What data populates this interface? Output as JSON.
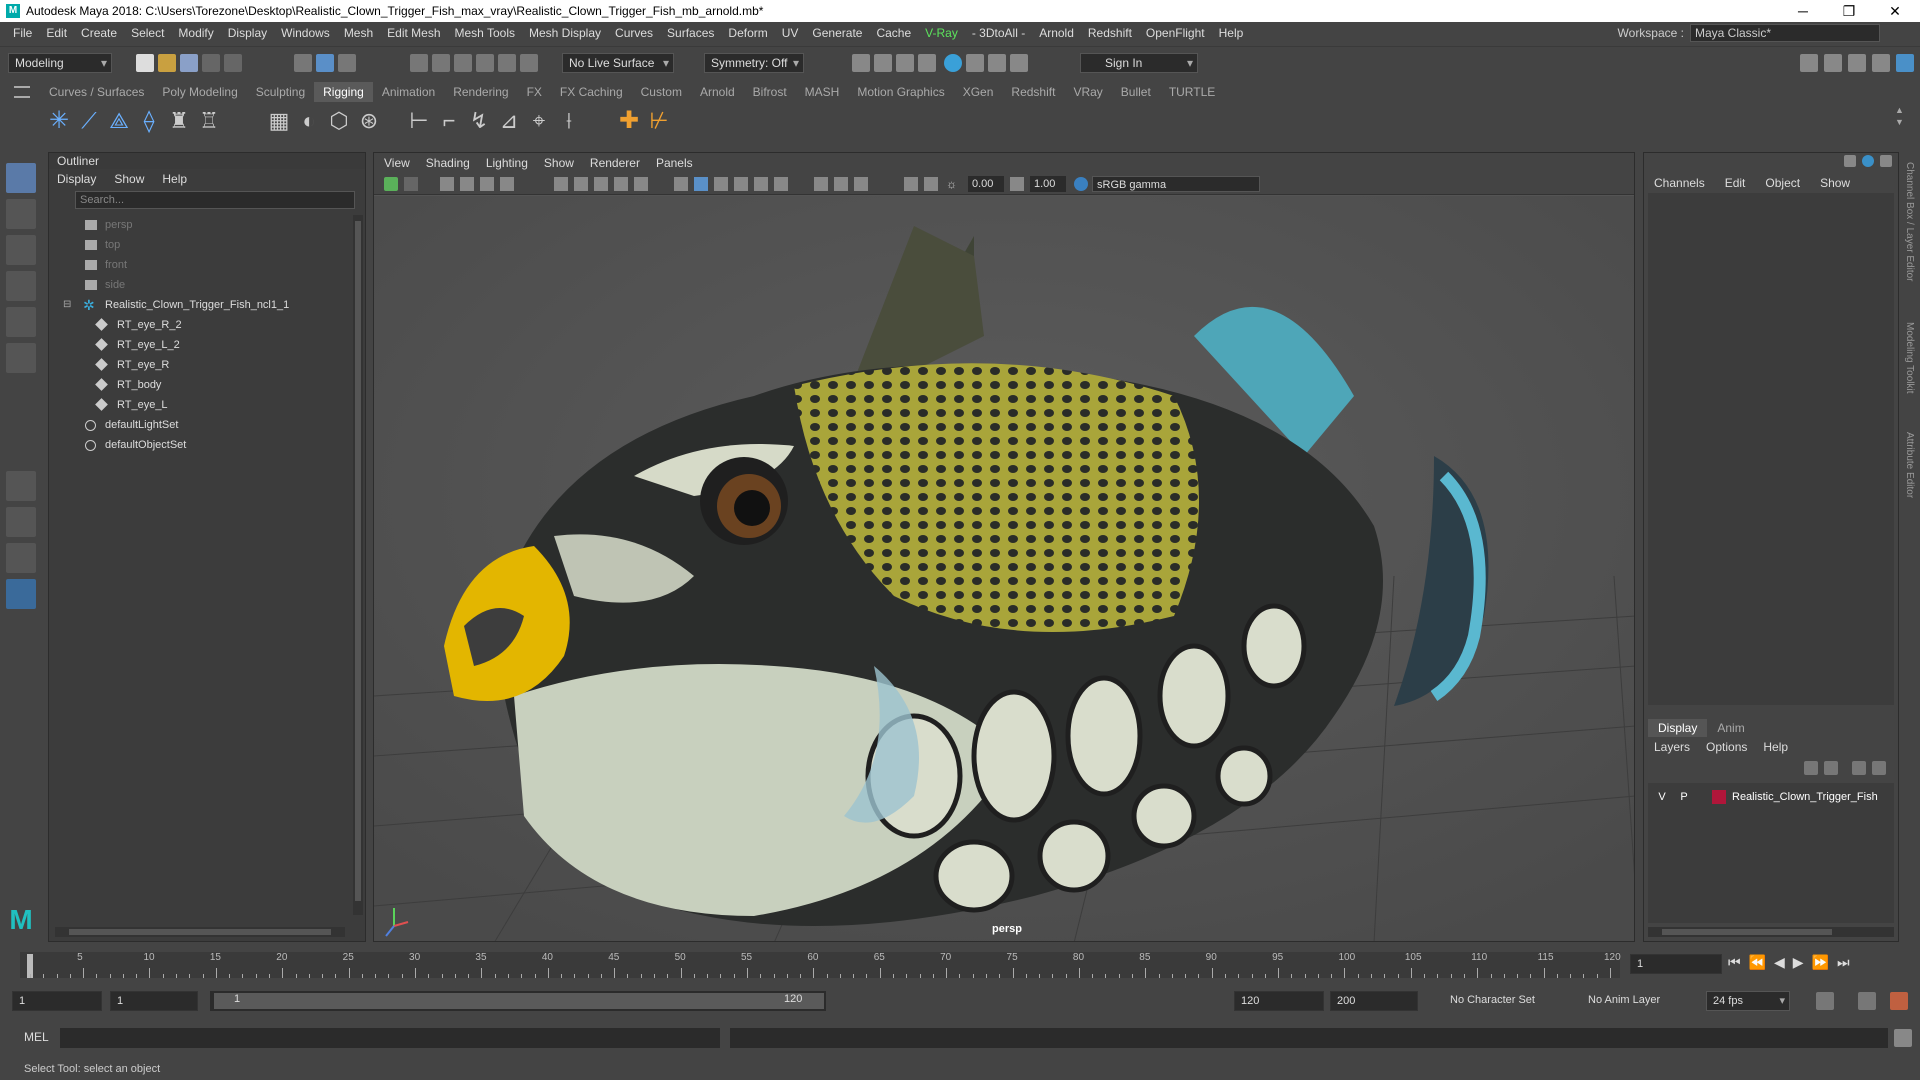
{
  "titlebar": {
    "logo": "M",
    "title": "Autodesk Maya 2018: C:\\Users\\Torezone\\Desktop\\Realistic_Clown_Trigger_Fish_max_vray\\Realistic_Clown_Trigger_Fish_mb_arnold.mb*",
    "min": "─",
    "max": "❐",
    "close": "✕"
  },
  "menubar": {
    "items": [
      "File",
      "Edit",
      "Create",
      "Select",
      "Modify",
      "Display",
      "Windows",
      "Mesh",
      "Edit Mesh",
      "Mesh Tools",
      "Mesh Display",
      "Curves",
      "Surfaces",
      "Deform",
      "UV",
      "Generate",
      "Cache",
      "V-Ray",
      "- 3DtoAll -",
      "Arnold",
      "Redshift",
      "OpenFlight",
      "Help"
    ]
  },
  "workspace": {
    "label": "Workspace :",
    "value": "Maya Classic*"
  },
  "statusline": {
    "mode": "Modeling",
    "live_surface": "No Live Surface",
    "symmetry": "Symmetry: Off",
    "sign_in": "Sign In"
  },
  "shelf": {
    "tabs": [
      "Curves / Surfaces",
      "Poly Modeling",
      "Sculpting",
      "Rigging",
      "Animation",
      "Rendering",
      "FX",
      "FX Caching",
      "Custom",
      "Arnold",
      "Bifrost",
      "MASH",
      "Motion Graphics",
      "XGen",
      "Redshift",
      "VRay",
      "Bullet",
      "TURTLE"
    ],
    "active": "Rigging"
  },
  "outliner": {
    "title": "Outliner",
    "menu": [
      "Display",
      "Show",
      "Help"
    ],
    "search_placeholder": "Search...",
    "items": [
      {
        "label": "persp",
        "kind": "camera",
        "depth": 0
      },
      {
        "label": "top",
        "kind": "camera",
        "depth": 0
      },
      {
        "label": "front",
        "kind": "camera",
        "depth": 0
      },
      {
        "label": "side",
        "kind": "camera",
        "depth": 0
      },
      {
        "label": "Realistic_Clown_Trigger_Fish_ncl1_1",
        "kind": "group",
        "depth": 0
      },
      {
        "label": "RT_eye_R_2",
        "kind": "mesh",
        "depth": 1
      },
      {
        "label": "RT_eye_L_2",
        "kind": "mesh",
        "depth": 1
      },
      {
        "label": "RT_eye_R",
        "kind": "mesh",
        "depth": 1
      },
      {
        "label": "RT_body",
        "kind": "mesh",
        "depth": 1
      },
      {
        "label": "RT_eye_L",
        "kind": "mesh",
        "depth": 1
      },
      {
        "label": "defaultLightSet",
        "kind": "set",
        "depth": 0
      },
      {
        "label": "defaultObjectSet",
        "kind": "set",
        "depth": 0
      }
    ]
  },
  "viewport": {
    "menu": [
      "View",
      "Shading",
      "Lighting",
      "Show",
      "Renderer",
      "Panels"
    ],
    "exposure": "0.00",
    "gamma": "1.00",
    "color_space": "sRGB gamma",
    "camera_label": "persp"
  },
  "channelbox": {
    "menu": [
      "Channels",
      "Edit",
      "Object",
      "Show"
    ],
    "layer_tabs": [
      "Display",
      "Anim"
    ],
    "layer_menu": [
      "Layers",
      "Options",
      "Help"
    ],
    "layer": {
      "v": "V",
      "p": "P",
      "name": "Realistic_Clown_Trigger_Fish",
      "color": "#b0163a"
    }
  },
  "side_tabs": [
    "Channel Box / Layer Editor",
    "Modeling Toolkit",
    "Attribute Editor"
  ],
  "timeslider": {
    "ticks": [
      5,
      10,
      15,
      20,
      25,
      30,
      35,
      40,
      45,
      50,
      55,
      60,
      65,
      70,
      75,
      80,
      85,
      90,
      95,
      100,
      105,
      110,
      115,
      120
    ],
    "min": 1,
    "max": 120,
    "current_frame": "1"
  },
  "rangebar": {
    "start": "1",
    "anim_start": "1",
    "range_start": "1",
    "range_end": "120",
    "end": "120",
    "anim_end": "200",
    "character_set": "No Character Set",
    "anim_layer": "No Anim Layer",
    "fps": "24 fps"
  },
  "cmdline": {
    "label": "MEL"
  },
  "helpline": {
    "text": "Select Tool: select an object"
  }
}
